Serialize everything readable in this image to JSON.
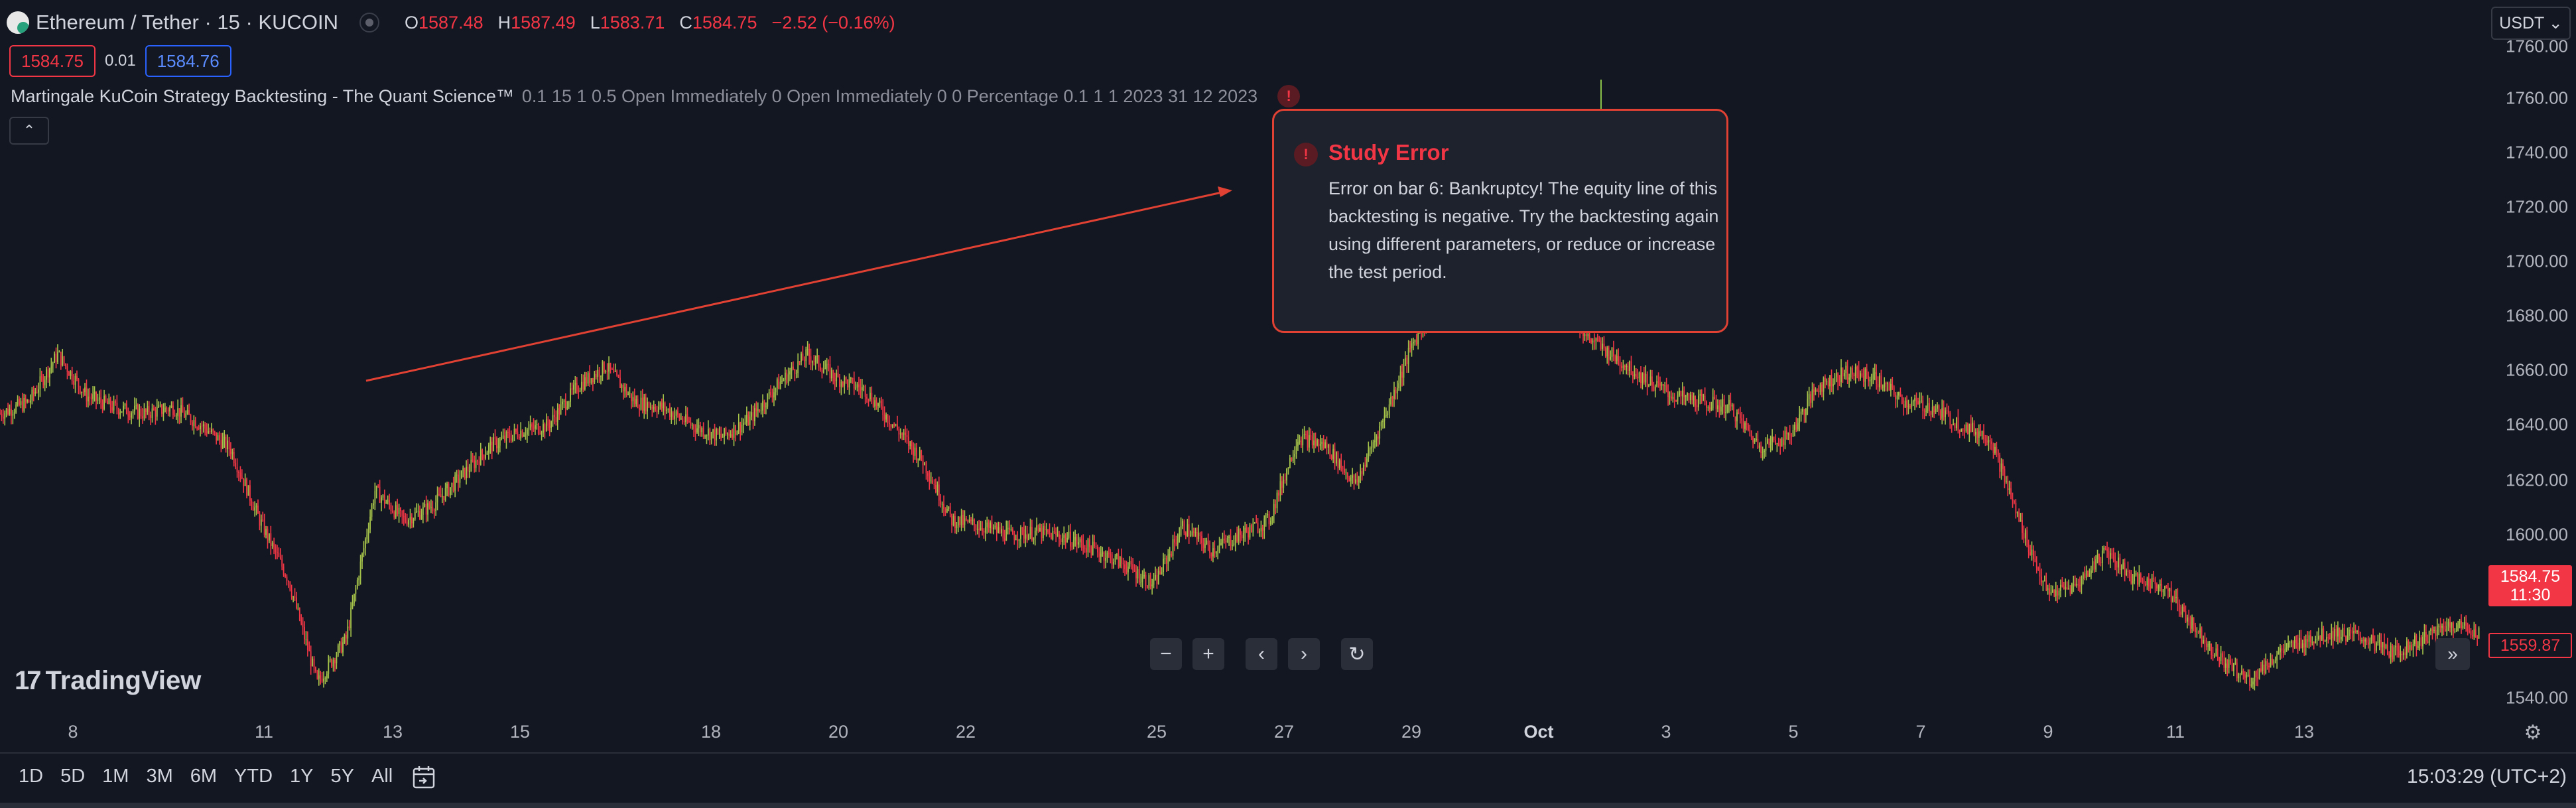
{
  "header": {
    "symbol_title": "Ethereum / Tether · 15 · KUCOIN",
    "ohlc": {
      "o_label": "O",
      "o_value": "1587.48",
      "h_label": "H",
      "h_value": "1587.49",
      "l_label": "L",
      "l_value": "1583.71",
      "c_label": "C",
      "c_value": "1584.75",
      "change": "−2.52 (−0.16%)"
    },
    "sell_price": "1584.75",
    "spread": "0.01",
    "buy_price": "1584.76"
  },
  "study": {
    "name": "Martingale KuCoin Strategy Backtesting - The Quant Science™",
    "params": "0.1 15 1 0.5 Open Immediately 0 Open Immediately 0 0 Percentage 0.1 1 1 2023 31 12 2023",
    "error_icon": "!"
  },
  "popup": {
    "icon": "!",
    "title": "Study Error",
    "message": "Error on bar 6: Bankruptcy! The equity line of this backtesting is negative. Try the backtesting again using different parameters, or reduce or increase the test period."
  },
  "price_scale": {
    "currency_button": "USDT ⌄",
    "ticks": [
      "1760.00",
      "1740.00",
      "1720.00",
      "1700.00",
      "1680.00",
      "1660.00",
      "1640.00",
      "1620.00",
      "1600.00",
      "1540.00"
    ],
    "last_price": "1584.75",
    "countdown": "11:30",
    "mark_price": "1559.87"
  },
  "time_scale": {
    "labels": [
      "8",
      "11",
      "13",
      "15",
      "18",
      "20",
      "22",
      "25",
      "27",
      "29",
      "Oct",
      "3",
      "5",
      "7",
      "9",
      "11",
      "13"
    ]
  },
  "toolbar": {
    "ranges": [
      "1D",
      "5D",
      "1M",
      "3M",
      "6M",
      "YTD",
      "1Y",
      "5Y",
      "All"
    ],
    "clock": "15:03:29 (UTC+2)"
  },
  "logo": {
    "text": "TradingView",
    "mark": "17"
  },
  "nav": {
    "zoom_out": "−",
    "zoom_in": "+",
    "prev": "‹",
    "next": "›",
    "reset": "↻",
    "scroll_right": "»"
  },
  "colors": {
    "background": "#131722",
    "up": "#8bc34a",
    "down": "#f23645",
    "candle_up": "#a6c34a",
    "arrow": "#e04133",
    "accent": "#2962ff"
  },
  "chart_data": {
    "type": "candlestick",
    "y_range": [
      1530,
      1770
    ],
    "path_close": [
      1636,
      1640,
      1656,
      1642,
      1638,
      1636,
      1638,
      1632,
      1624,
      1600,
      1580,
      1545,
      1560,
      1610,
      1600,
      1605,
      1615,
      1625,
      1630,
      1632,
      1645,
      1652,
      1640,
      1638,
      1632,
      1628,
      1634,
      1646,
      1656,
      1648,
      1644,
      1632,
      1620,
      1600,
      1598,
      1595,
      1596,
      1594,
      1590,
      1585,
      1578,
      1598,
      1590,
      1595,
      1600,
      1628,
      1625,
      1612,
      1635,
      1660,
      1676,
      1678,
      1680,
      1682,
      1678,
      1662,
      1655,
      1648,
      1642,
      1640,
      1638,
      1625,
      1628,
      1645,
      1650,
      1648,
      1640,
      1638,
      1632,
      1628,
      1600,
      1575,
      1578,
      1590,
      1580,
      1578,
      1565,
      1553,
      1546,
      1555,
      1560,
      1562,
      1560,
      1555,
      1560,
      1565,
      1562
    ]
  }
}
